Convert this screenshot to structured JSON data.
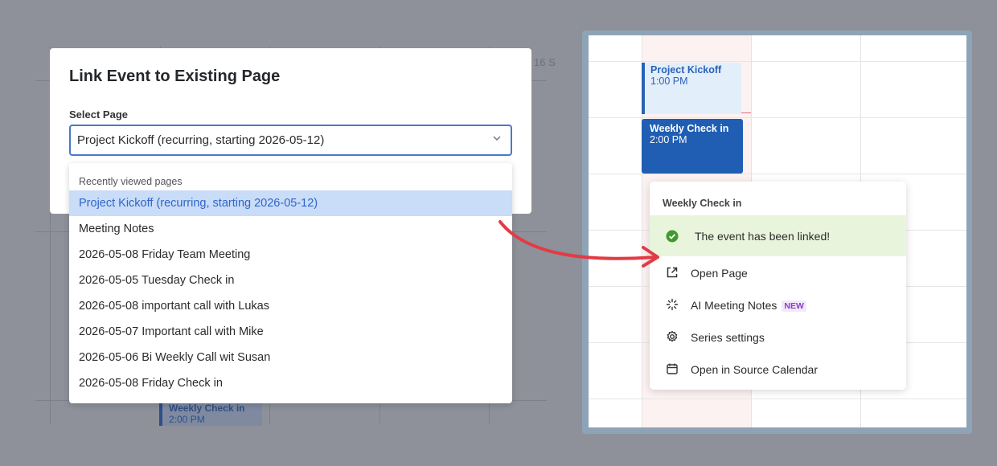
{
  "background_calendar": {
    "header_fragment": "16 S",
    "event": {
      "title": "Weekly Check in",
      "time": "2:00 PM"
    }
  },
  "modal": {
    "title": "Link Event to Existing Page",
    "select_label": "Select Page",
    "select_value": "Project Kickoff (recurring, starting 2026-05-12)",
    "caret_icon": "chevron-down-icon"
  },
  "dropdown": {
    "section_label": "Recently viewed pages",
    "items": [
      "Project Kickoff (recurring, starting 2026-05-12)",
      "Meeting Notes",
      "2026-05-08 Friday Team Meeting",
      "2026-05-05 Tuesday Check in",
      "2026-05-08 important call with Lukas",
      "2026-05-07 Important call with Mike",
      "2026-05-06 Bi Weekly Call wit Susan",
      "2026-05-08 Friday Check in"
    ],
    "selected_index": 0
  },
  "right_calendar": {
    "events": [
      {
        "title": "Project Kickoff",
        "time": "1:00 PM"
      },
      {
        "title": "Weekly Check in",
        "time": "2:00 PM"
      }
    ]
  },
  "popover": {
    "title": "Weekly Check in",
    "success_message": "The event has been linked!",
    "items": [
      {
        "label": "Open Page",
        "icon": "external-link-icon"
      },
      {
        "label": "AI Meeting Notes",
        "icon": "sparkle-icon",
        "badge": "NEW"
      },
      {
        "label": "Series settings",
        "icon": "gear-icon"
      },
      {
        "label": "Open in Source Calendar",
        "icon": "calendar-icon"
      }
    ]
  },
  "colors": {
    "accent": "#4a78c9",
    "selected_bg": "#c9dcf8",
    "success_bg": "#e8f5dc",
    "success_icon": "#3f9a2f",
    "arrow": "#e23b45",
    "badge": "#8a3fc4"
  }
}
